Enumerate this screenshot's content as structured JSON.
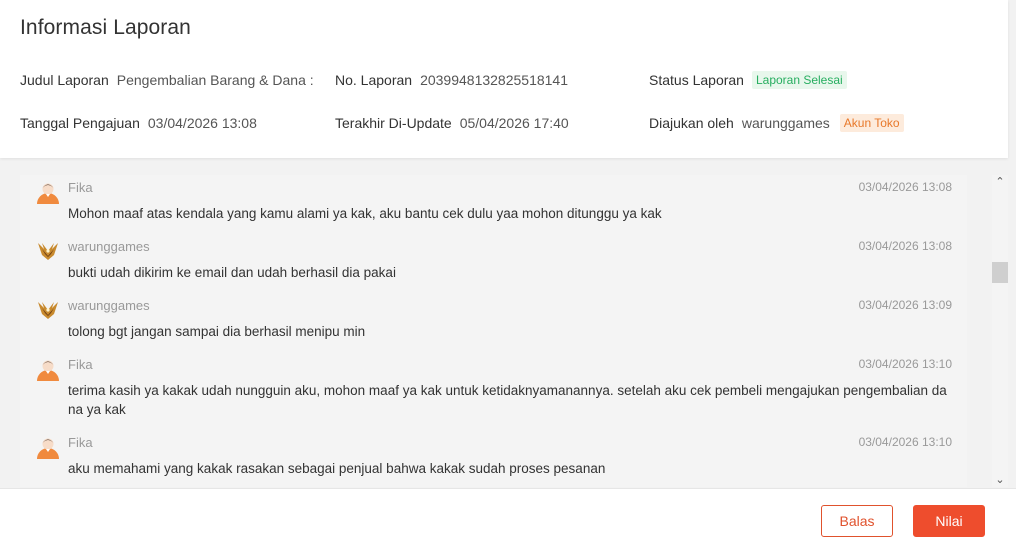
{
  "header": {
    "title": "Informasi Laporan"
  },
  "fields": {
    "judul": {
      "label": "Judul Laporan",
      "value": "Pengembalian Barang & Dana :"
    },
    "no": {
      "label": "No. Laporan",
      "value": "2039948132825518141"
    },
    "status": {
      "label": "Status Laporan",
      "badge": "Laporan Selesai"
    },
    "tanggal": {
      "label": "Tanggal Pengajuan",
      "value": "03/04/2026 13:08"
    },
    "update": {
      "label": "Terakhir Di-Update",
      "value": "05/04/2026 17:40"
    },
    "diajukan": {
      "label": "Diajukan oleh",
      "value": "warunggames",
      "badge": "Akun Toko"
    }
  },
  "messages": [
    {
      "author": "Fika",
      "avatar": "agent-avatar-icon",
      "time": "03/04/2026 13:08",
      "text": "Mohon maaf atas kendala yang kamu alami ya kak, aku bantu cek dulu yaa mohon ditunggu ya kak"
    },
    {
      "author": "warunggames",
      "avatar": "shop-avatar-icon",
      "time": "03/04/2026 13:08",
      "text": "bukti udah dikirim ke email dan udah berhasil dia pakai"
    },
    {
      "author": "warunggames",
      "avatar": "shop-avatar-icon",
      "time": "03/04/2026 13:09",
      "text": "tolong bgt jangan sampai dia berhasil menipu min"
    },
    {
      "author": "Fika",
      "avatar": "agent-avatar-icon",
      "time": "03/04/2026 13:10",
      "text": "terima kasih ya kakak udah nungguin aku, mohon maaf ya kak untuk ketidaknyamanannya. setelah aku cek pembeli mengajukan pengembalian dana ya kak"
    },
    {
      "author": "Fika",
      "avatar": "agent-avatar-icon",
      "time": "03/04/2026 13:10",
      "text": "aku memahami yang kakak rasakan sebagai penjual bahwa kakak sudah proses pesanan"
    }
  ],
  "actions": {
    "reply": "Balas",
    "rate": "Nilai"
  },
  "colors": {
    "accent": "#ee4d2d",
    "success": "#27ae60",
    "warning": "#e8782a"
  }
}
